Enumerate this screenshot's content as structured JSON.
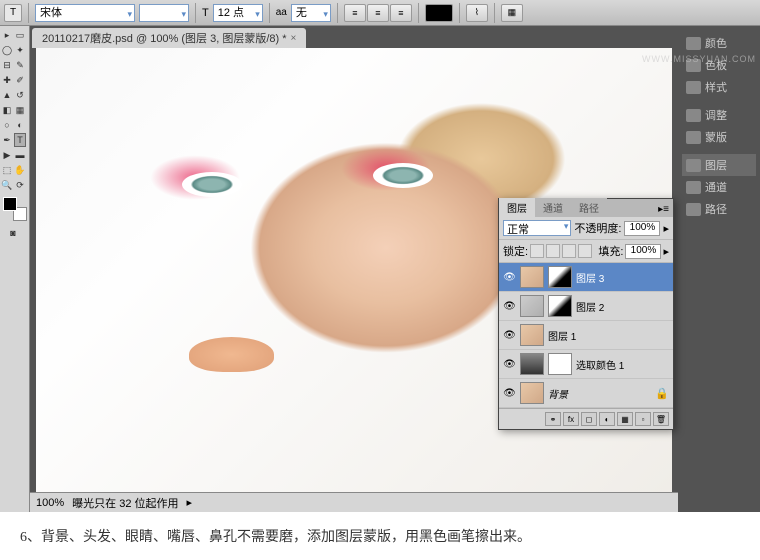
{
  "toolbar": {
    "font_select": "宋体",
    "size_label": "12 点",
    "aa_label": "无",
    "tool_icon": "T"
  },
  "tab": {
    "title": "20110217磨皮.psd @ 100% (图层 3, 图层蒙版/8) *"
  },
  "status": {
    "zoom": "100%",
    "info": "曝光只在 32 位起作用"
  },
  "dock": {
    "color": "颜色",
    "swatches": "色板",
    "styles": "样式",
    "adjustments": "调整",
    "masks": "蒙版",
    "layers": "图层",
    "channels": "通道",
    "paths": "路径"
  },
  "layers_panel": {
    "tabs": {
      "layers": "图层",
      "channels": "通道",
      "paths": "路径"
    },
    "blend_mode": "正常",
    "opacity_label": "不透明度:",
    "opacity_val": "100%",
    "lock_label": "锁定:",
    "fill_label": "填充:",
    "fill_val": "100%",
    "layers": [
      {
        "name": "图层 3",
        "selected": true,
        "has_mask": true
      },
      {
        "name": "图层 2",
        "selected": false,
        "has_mask": true
      },
      {
        "name": "图层 1",
        "selected": false,
        "has_mask": false
      },
      {
        "name": "选取颜色 1",
        "selected": false,
        "has_mask": true
      },
      {
        "name": "背景",
        "selected": false,
        "has_mask": false
      }
    ]
  },
  "caption": "6、背景、头发、眼睛、嘴唇、鼻孔不需要磨，添加图层蒙版，用黑色画笔擦出来。",
  "watermark": "WWW.MISSYUAN.COM"
}
